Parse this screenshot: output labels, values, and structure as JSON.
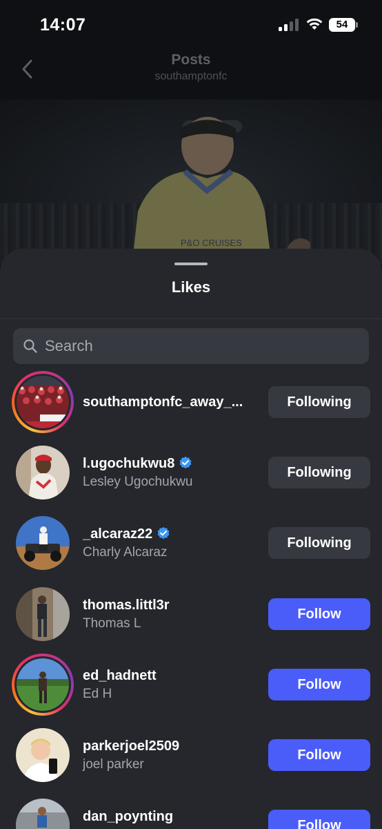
{
  "status_bar": {
    "time": "14:07",
    "battery": "54"
  },
  "header": {
    "title": "Posts",
    "subtitle": "southamptonfc"
  },
  "post": {
    "sponsor_text": "P&O CRUISES"
  },
  "sheet": {
    "title": "Likes",
    "search": {
      "placeholder": "Search",
      "value": ""
    }
  },
  "likes": [
    {
      "username": "southamptonfc_away_...",
      "full_name": "",
      "verified": false,
      "button": "Following",
      "button_state": "following",
      "story_ring": true,
      "avatar_icon": "crowd-photo-avatar"
    },
    {
      "username": "l.ugochukwu8",
      "full_name": "Lesley Ugochukwu",
      "verified": true,
      "button": "Following",
      "button_state": "following",
      "story_ring": false,
      "avatar_icon": "person-photo-avatar"
    },
    {
      "username": "_alcaraz22",
      "full_name": "Charly Alcaraz",
      "verified": true,
      "button": "Following",
      "button_state": "following",
      "story_ring": false,
      "avatar_icon": "desert-quad-photo-avatar"
    },
    {
      "username": "thomas.littl3r",
      "full_name": "Thomas L",
      "verified": false,
      "button": "Follow",
      "button_state": "follow",
      "story_ring": false,
      "avatar_icon": "mirror-selfie-avatar"
    },
    {
      "username": "ed_hadnett",
      "full_name": "Ed H",
      "verified": false,
      "button": "Follow",
      "button_state": "follow",
      "story_ring": true,
      "avatar_icon": "field-photo-avatar"
    },
    {
      "username": "parkerjoel2509",
      "full_name": "joel parker",
      "verified": false,
      "button": "Follow",
      "button_state": "follow",
      "story_ring": false,
      "avatar_icon": "selfie-photo-avatar"
    },
    {
      "username": "dan_poynting",
      "full_name": "",
      "verified": false,
      "button": "Follow",
      "button_state": "follow",
      "story_ring": false,
      "avatar_icon": "runner-photo-avatar"
    }
  ],
  "colors": {
    "follow_blue": "#4a5df9",
    "following_gray": "#363940",
    "verified_blue": "#3b97f3",
    "sheet_bg": "#25272c"
  }
}
